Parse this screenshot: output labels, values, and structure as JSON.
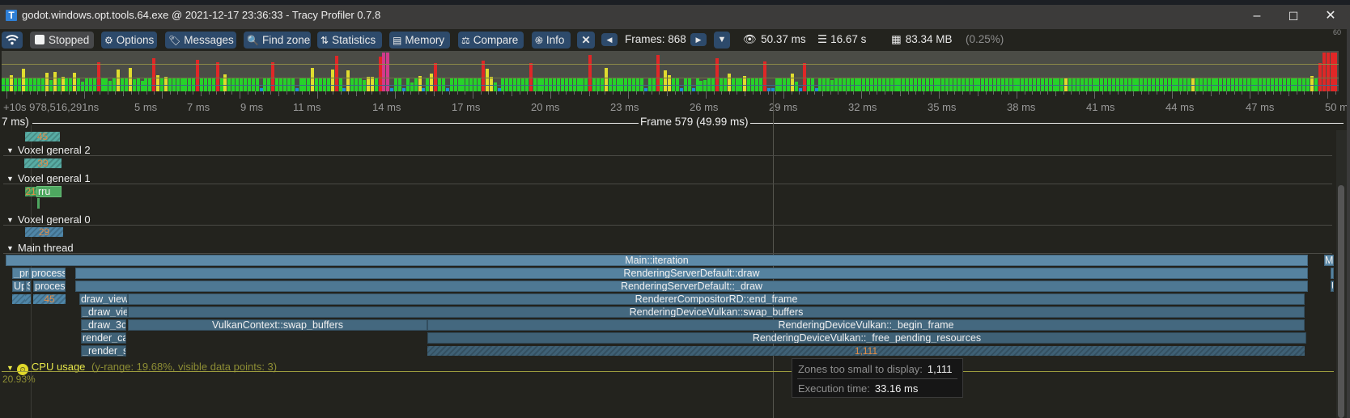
{
  "window": {
    "title": "godot.windows.opt.tools.64.exe @ 2021-12-17 23:36:33 - Tracy Profiler 0.7.8",
    "app_icon": "T",
    "minimize": "–",
    "maximize": "☐",
    "close": "✕"
  },
  "toolbar": {
    "connection_icon": "wifi-icon",
    "stopped_label": "Stopped",
    "options_label": "Options",
    "messages_label": "Messages",
    "find_zone_label": "Find zone",
    "statistics_label": "Statistics",
    "memory_label": "Memory",
    "compare_label": "Compare",
    "info_label": "Info",
    "frames_label": "Frames: 868",
    "view_time": "50.37 ms",
    "total_time": "16.67 s",
    "memory_usage": "83.34 MB",
    "memory_percent": "(0.25%)"
  },
  "frame_graph": {
    "max_label": "60",
    "colors": {
      "good": "#26d22a",
      "ok": "#e0dc2e",
      "bad": "#e02727",
      "tiny": "#1e8fd6",
      "selected": "#d23a8c"
    }
  },
  "timeline": {
    "ticks": [
      "+10s 978,516,291ns",
      "5 ms",
      "7 ms",
      "9 ms",
      "11 ms",
      "14 ms",
      "17 ms",
      "20 ms",
      "23 ms",
      "26 ms",
      "29 ms",
      "32 ms",
      "35 ms",
      "38 ms",
      "41 ms",
      "44 ms",
      "47 ms",
      "50 ms"
    ],
    "prev_frame_label": "7 ms)",
    "frame_label": "Frame 579 (49.99 ms)"
  },
  "threads": [
    {
      "name": "",
      "small_count": "45"
    },
    {
      "name": "Voxel general 2",
      "small_count": "39"
    },
    {
      "name": "Voxel general 1",
      "small_count": "21",
      "zone_label": "rru"
    },
    {
      "name": "Voxel general 0",
      "small_count": "29"
    },
    {
      "name": "Main thread"
    }
  ],
  "main_thread": {
    "main_iteration": "Main::iteration",
    "main_iteration_next": "M",
    "rs_draw": "RenderingServerDefault::draw",
    "rs_draw_inner": "RenderingServerDefault::_draw",
    "proc1": "_prc",
    "proc2": "process",
    "proc3": "Up",
    "proc4": "S",
    "proc5": "proces",
    "small_45": "45",
    "draw_view": "draw_view",
    "draw_vie": "_draw_vie",
    "draw_3d": "_draw_3c",
    "render_ca": "render_ca",
    "render_s": "_render_s",
    "end_frame": "RendererCompositorRD::end_frame",
    "swap_buffers": "RenderingDeviceVulkan::swap_buffers",
    "vk_swap_buffers": "VulkanContext::swap_buffers",
    "begin_frame": "RenderingDeviceVulkan::_begin_frame",
    "free_pending": "RenderingDeviceVulkan::_free_pending_resources",
    "small_1111": "1,111",
    "next_u": "U"
  },
  "cpu_usage": {
    "label": "CPU usage",
    "info": "(y-range: 19.68%, visible data points: 3)",
    "value": "20.93%"
  },
  "tooltip": {
    "zones_label": "Zones too small to display:",
    "zones_value": "1,111",
    "exec_label": "Execution time:",
    "exec_value": "33.16 ms"
  }
}
